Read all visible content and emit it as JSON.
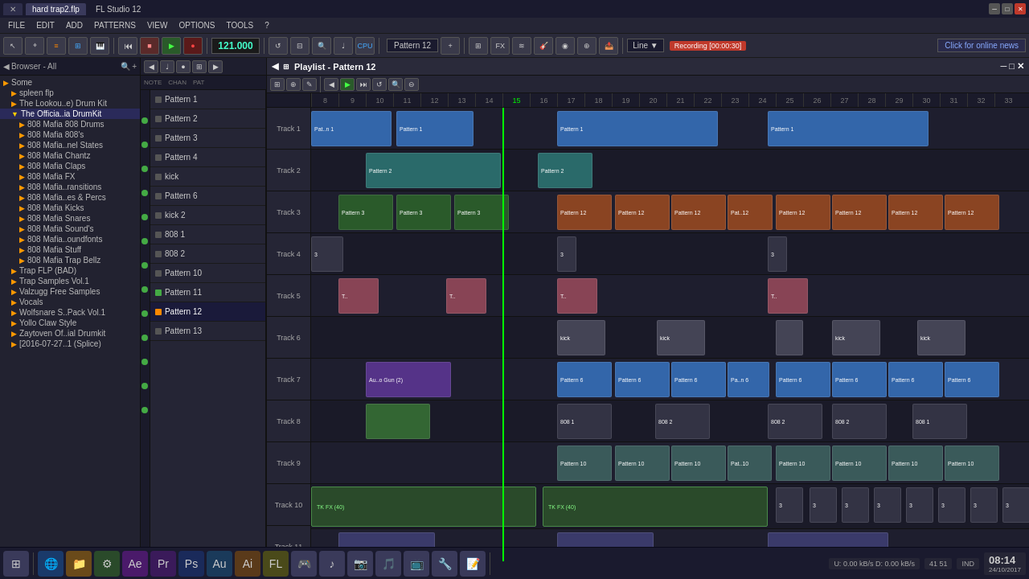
{
  "title_bar": {
    "tab_label": "hard trap2.flp",
    "window_title": "FL Studio 12"
  },
  "menu": {
    "items": [
      "FILE",
      "EDIT",
      "ADD",
      "PATTERNS",
      "VIEW",
      "OPTIONS",
      "TOOLS",
      "?"
    ]
  },
  "toolbar": {
    "bpm": "121.000",
    "recording_label": "Recording [00:00:30]",
    "pattern_label": "Pattern 12",
    "line_label": "Line",
    "online_news_label": "Click for online news"
  },
  "sidebar": {
    "header": "Browser - All",
    "items": [
      {
        "label": "Some",
        "type": "folder",
        "indent": 0
      },
      {
        "label": "spleen flp",
        "type": "folder",
        "indent": 1
      },
      {
        "label": "The Lookou..e) Drum Kit",
        "type": "folder",
        "indent": 1
      },
      {
        "label": "The Officia..ia DrumKit",
        "type": "folder-open",
        "indent": 1,
        "highlighted": true
      },
      {
        "label": "808 Mafia 808 Drums",
        "type": "folder",
        "indent": 2
      },
      {
        "label": "808 Mafia 808's",
        "type": "folder",
        "indent": 2
      },
      {
        "label": "808 Mafia..nel States",
        "type": "folder",
        "indent": 2
      },
      {
        "label": "808 Mafia Chantz",
        "type": "folder",
        "indent": 2
      },
      {
        "label": "808 Mafia Claps",
        "type": "folder",
        "indent": 2
      },
      {
        "label": "808 Mafia FX",
        "type": "folder",
        "indent": 2
      },
      {
        "label": "808 Mafia..ransitions",
        "type": "folder",
        "indent": 2
      },
      {
        "label": "808 Mafia..es & Percs",
        "type": "folder",
        "indent": 2
      },
      {
        "label": "808 Mafia Kicks",
        "type": "folder",
        "indent": 2
      },
      {
        "label": "808 Mafia Snares",
        "type": "folder",
        "indent": 2
      },
      {
        "label": "808 Mafia Sound's",
        "type": "folder",
        "indent": 2
      },
      {
        "label": "808 Mafia..oundfonts",
        "type": "folder",
        "indent": 2
      },
      {
        "label": "808 Mafia Stuff",
        "type": "folder",
        "indent": 2
      },
      {
        "label": "808 Mafia Trap Bellz",
        "type": "folder",
        "indent": 2
      },
      {
        "label": "Trap FLP (BAD)",
        "type": "folder",
        "indent": 1
      },
      {
        "label": "Trap Samples Vol.1",
        "type": "folder",
        "indent": 1
      },
      {
        "label": "Valzugg Free Samples",
        "type": "folder",
        "indent": 1
      },
      {
        "label": "Vocals",
        "type": "folder",
        "indent": 1
      },
      {
        "label": "Wolfsnare S..Pack Vol.1",
        "type": "folder",
        "indent": 1
      },
      {
        "label": "Yollo Claw Style",
        "type": "folder",
        "indent": 1
      },
      {
        "label": "Zaytoven Of..ial Drumkit",
        "type": "folder",
        "indent": 1
      },
      {
        "label": "[2016-07-27..1 (Splice)",
        "type": "folder",
        "indent": 1
      }
    ]
  },
  "patterns": {
    "items": [
      {
        "label": "Pattern 1",
        "color": "gray"
      },
      {
        "label": "Pattern 2",
        "color": "gray"
      },
      {
        "label": "Pattern 3",
        "color": "gray"
      },
      {
        "label": "Pattern 4",
        "color": "gray"
      },
      {
        "label": "kick",
        "color": "gray"
      },
      {
        "label": "Pattern 6",
        "color": "gray"
      },
      {
        "label": "kick 2",
        "color": "gray"
      },
      {
        "label": "808 1",
        "color": "gray"
      },
      {
        "label": "808 2",
        "color": "gray"
      },
      {
        "label": "Pattern 10",
        "color": "gray"
      },
      {
        "label": "Pattern 11",
        "color": "green"
      },
      {
        "label": "Pattern 12",
        "color": "orange",
        "active": true
      },
      {
        "label": "Pattern 13",
        "color": "gray"
      }
    ]
  },
  "playlist": {
    "title": "Playlist - Pattern 12",
    "tracks": [
      {
        "label": "Track 1"
      },
      {
        "label": "Track 2"
      },
      {
        "label": "Track 3"
      },
      {
        "label": "Track 4"
      },
      {
        "label": "Track 5"
      },
      {
        "label": "Track 6"
      },
      {
        "label": "Track 7"
      },
      {
        "label": "Track 8"
      },
      {
        "label": "Track 9"
      },
      {
        "label": "Track 10"
      },
      {
        "label": "Track 11"
      }
    ],
    "ruler_marks": [
      "8",
      "9",
      "10",
      "11",
      "12",
      "13",
      "14",
      "15",
      "16",
      "17",
      "18",
      "19",
      "20",
      "21",
      "22",
      "23",
      "24",
      "25",
      "26",
      "27",
      "28",
      "29",
      "30",
      "31",
      "32",
      "33"
    ]
  },
  "taskbar": {
    "time": "08:14",
    "date": "24/10/2017",
    "bpm_status": "U: 0.00 kB/s D: 0.00 kB/s",
    "ind_label": "IND",
    "nums": "41  51"
  }
}
